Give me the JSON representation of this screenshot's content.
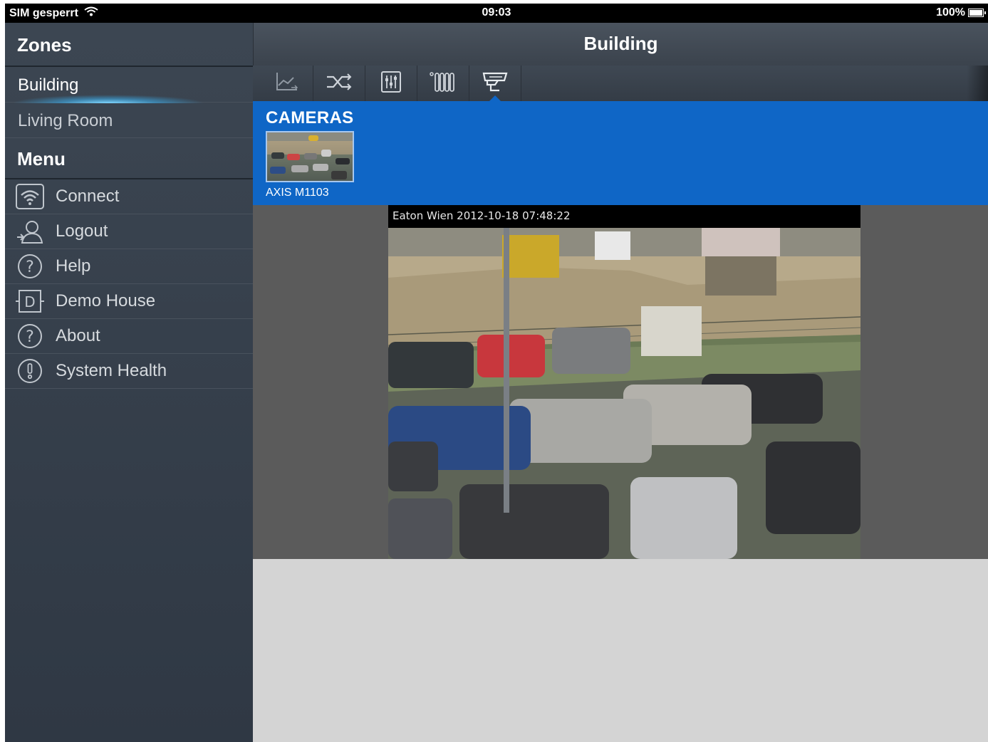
{
  "status_bar": {
    "carrier": "SIM gesperrt",
    "time": "09:03",
    "battery": "100%"
  },
  "sidebar": {
    "zones_header": "Zones",
    "zones": [
      {
        "label": "Building",
        "active": true
      },
      {
        "label": "Living Room",
        "active": false
      }
    ],
    "menu_header": "Menu",
    "menu_items": [
      {
        "label": "Connect",
        "icon": "wifi-icon"
      },
      {
        "label": "Logout",
        "icon": "logout-user-icon"
      },
      {
        "label": "Help",
        "icon": "question-circle-icon"
      },
      {
        "label": "Demo House",
        "icon": "demo-house-icon"
      },
      {
        "label": "About",
        "icon": "question-circle-icon"
      },
      {
        "label": "System Health",
        "icon": "exclamation-circle-icon"
      }
    ]
  },
  "main": {
    "title": "Building",
    "toolbar": [
      {
        "icon": "chart-icon",
        "active": false
      },
      {
        "icon": "shuffle-icon",
        "active": false
      },
      {
        "icon": "sliders-icon",
        "active": false
      },
      {
        "icon": "heater-icon",
        "active": false
      },
      {
        "icon": "camera-icon",
        "active": true
      }
    ],
    "cameras": {
      "title": "CAMERAS",
      "items": [
        {
          "name": "AXIS M1103"
        }
      ]
    },
    "feed": {
      "timestamp": "Eaton Wien 2012-10-18 07:48:22"
    }
  },
  "colors": {
    "accent": "#0f66c6",
    "sidebar": "#343d48",
    "status_bar": "#000000"
  }
}
